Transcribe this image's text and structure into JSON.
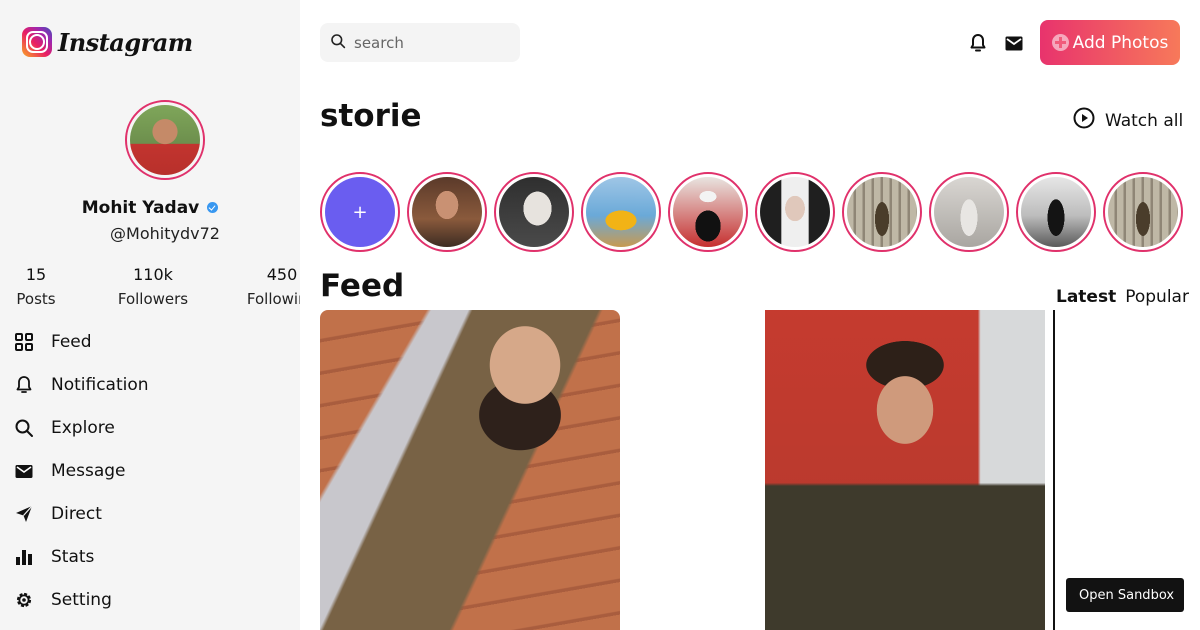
{
  "brand": {
    "logo_text": "Instagram"
  },
  "profile": {
    "name": "Mohit Yadav",
    "handle": "@Mohitydv72",
    "verified": true,
    "stats": [
      {
        "value": "15",
        "label": "Posts"
      },
      {
        "value": "110k",
        "label": "Followers"
      },
      {
        "value": "450",
        "label": "Following"
      }
    ]
  },
  "nav": {
    "items": [
      {
        "label": "Feed",
        "icon": "grid-icon"
      },
      {
        "label": "Notification",
        "icon": "bell-icon"
      },
      {
        "label": "Explore",
        "icon": "search-icon"
      },
      {
        "label": "Message",
        "icon": "mail-icon"
      },
      {
        "label": "Direct",
        "icon": "send-icon"
      },
      {
        "label": "Stats",
        "icon": "bar-chart-icon"
      },
      {
        "label": "Setting",
        "icon": "gear-icon"
      }
    ]
  },
  "header": {
    "search_placeholder": "search",
    "add_button_label": "Add Photos"
  },
  "stories": {
    "title": "storie",
    "watch_all_label": "Watch all",
    "add_label": "+",
    "items": [
      {
        "name": "story-1"
      },
      {
        "name": "story-2"
      },
      {
        "name": "story-3"
      },
      {
        "name": "story-4"
      },
      {
        "name": "story-5"
      },
      {
        "name": "story-6"
      },
      {
        "name": "story-7"
      },
      {
        "name": "story-8"
      },
      {
        "name": "story-9"
      }
    ]
  },
  "feed": {
    "title": "Feed",
    "tabs": [
      {
        "label": "Latest",
        "active": true
      },
      {
        "label": "Popular",
        "active": false
      }
    ]
  },
  "sandbox": {
    "label": "Open Sandbox"
  },
  "colors": {
    "accent_gradient_start": "#e8336d",
    "accent_gradient_end": "#f7795a",
    "story_ring": "#e0316b",
    "verified": "#3897f0"
  }
}
